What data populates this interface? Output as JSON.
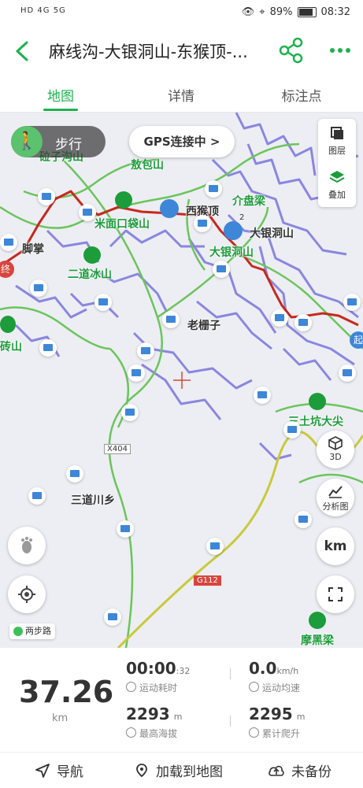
{
  "status_bar": {
    "network": "HD 4G 5G",
    "battery_percent": "89%",
    "time": "08:32"
  },
  "header": {
    "title": "麻线沟-大银洞山-东猴顶-..."
  },
  "tabs": [
    {
      "label": "地图",
      "active": true
    },
    {
      "label": "详情",
      "active": false
    },
    {
      "label": "标注点",
      "active": false
    }
  ],
  "map": {
    "walk_mode": "步行",
    "gps_status": "GPS连接中 >",
    "layers_label": "图层",
    "overlay_label": "叠加",
    "btn_3d": "3D",
    "analysis_label": "分析图",
    "unit_toggle": "km",
    "route_type": "两步路",
    "places": [
      {
        "name": "砬子沟山",
        "style": "green"
      },
      {
        "name": "敖包山",
        "style": "green"
      },
      {
        "name": "米面口袋山",
        "style": "green"
      },
      {
        "name": "西猴顶",
        "style": "dark"
      },
      {
        "name": "介盘梁",
        "style": "green"
      },
      {
        "name": "大银洞山",
        "style": "dark"
      },
      {
        "name": "大银洞山",
        "style": "green"
      },
      {
        "name": "脚掌",
        "style": "dark"
      },
      {
        "name": "二道冰山",
        "style": "green"
      },
      {
        "name": "老栅子",
        "style": "dark"
      },
      {
        "name": "砖山",
        "style": "green"
      },
      {
        "name": "三土坑大尖",
        "style": "green"
      },
      {
        "name": "三道川乡",
        "style": "dark"
      },
      {
        "name": "摩黑梁",
        "style": "green"
      }
    ],
    "roads": [
      "X404",
      "G112"
    ],
    "start_label": "起",
    "end_label": "终",
    "waypoint_number": "2"
  },
  "stats": {
    "distance": "37.26",
    "distance_unit": "km",
    "duration": "00:00",
    "duration_sec": ":32",
    "duration_label": "运动耗时",
    "speed": "0.0",
    "speed_unit": "km/h",
    "speed_label": "运动均速",
    "max_alt": "2293",
    "max_alt_unit": "m",
    "max_alt_label": "最高海拔",
    "climb": "2295",
    "climb_unit": "m",
    "climb_label": "累计爬升"
  },
  "bottom_bar": {
    "navigate": "导航",
    "load_to_map": "加载到地图",
    "backup": "未备份"
  },
  "colors": {
    "accent": "#1db14f",
    "track": "#c8281e",
    "contour": "#8a86e0",
    "road": "#6cc45c",
    "highway": "#c9c93a"
  }
}
